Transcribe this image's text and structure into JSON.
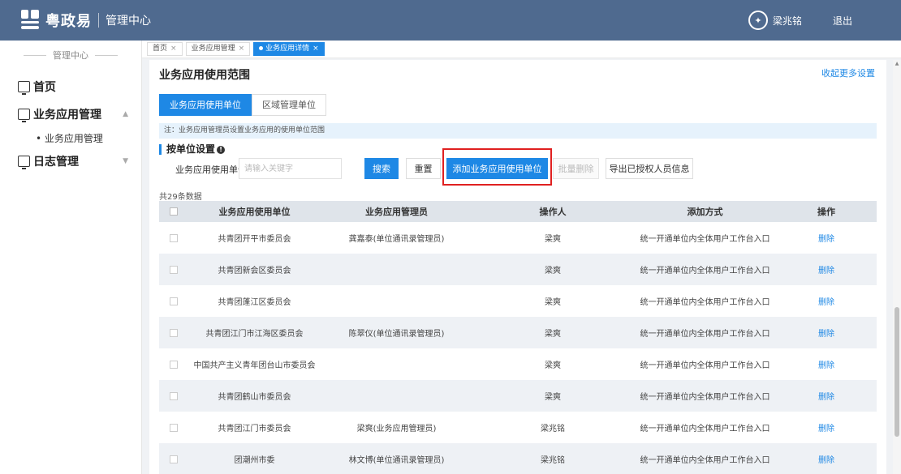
{
  "header": {
    "brand_name": "粤政易",
    "brand_sub": "管理中心",
    "user_name": "梁兆铭",
    "logout_label": "退出"
  },
  "sidebar": {
    "title": "管理中心",
    "items": [
      {
        "label": "首页"
      },
      {
        "label": "业务应用管理"
      },
      {
        "label": "日志管理"
      }
    ],
    "sub_items": [
      {
        "label": "• 业务应用管理"
      }
    ]
  },
  "tabs": [
    {
      "label": "首页"
    },
    {
      "label": "业务应用管理"
    },
    {
      "label": "业务应用详情"
    }
  ],
  "main": {
    "title": "业务应用使用范围",
    "collapse_link": "收起更多设置",
    "inner_tabs": [
      {
        "label": "业务应用使用单位"
      },
      {
        "label": "区域管理单位"
      }
    ],
    "notice": "注：业务应用管理员设置业务应用的使用单位范围",
    "section_title": "按单位设置",
    "filter_label": "业务应用使用单位",
    "filter_placeholder": "请输入关键字",
    "filter_value": "",
    "buttons": {
      "search": "搜索",
      "reset": "重置",
      "add": "添加业务应用使用单位",
      "batch_delete": "批量删除",
      "export": "导出已授权人员信息"
    },
    "count_text": "共29条数据"
  },
  "table": {
    "headers": [
      "业务应用使用单位",
      "业务应用管理员",
      "操作人",
      "添加方式",
      "操作"
    ],
    "rows": [
      {
        "unit": "共青团开平市委员会",
        "admin": "龚嘉泰(单位通讯录管理员)",
        "operator": "梁爽",
        "method": "统一开通单位内全体用户工作台入口",
        "action": "删除"
      },
      {
        "unit": "共青团新会区委员会",
        "admin": "",
        "operator": "梁爽",
        "method": "统一开通单位内全体用户工作台入口",
        "action": "删除"
      },
      {
        "unit": "共青团蓬江区委员会",
        "admin": "",
        "operator": "梁爽",
        "method": "统一开通单位内全体用户工作台入口",
        "action": "删除"
      },
      {
        "unit": "共青团江门市江海区委员会",
        "admin": "陈翠仪(单位通讯录管理员)",
        "operator": "梁爽",
        "method": "统一开通单位内全体用户工作台入口",
        "action": "删除"
      },
      {
        "unit": "中国共产主义青年团台山市委员会",
        "admin": "",
        "operator": "梁爽",
        "method": "统一开通单位内全体用户工作台入口",
        "action": "删除"
      },
      {
        "unit": "共青团鹤山市委员会",
        "admin": "",
        "operator": "梁爽",
        "method": "统一开通单位内全体用户工作台入口",
        "action": "删除"
      },
      {
        "unit": "共青团江门市委员会",
        "admin": "梁爽(业务应用管理员)",
        "operator": "梁兆铭",
        "method": "统一开通单位内全体用户工作台入口",
        "action": "删除"
      },
      {
        "unit": "团潮州市委",
        "admin": "林文博(单位通讯录管理员)",
        "operator": "梁兆铭",
        "method": "统一开通单位内全体用户工作台入口",
        "action": "删除"
      }
    ]
  },
  "colors": {
    "header_bg": "#4f6a8f",
    "accent": "#1e88e5",
    "highlight": "#e02020"
  }
}
